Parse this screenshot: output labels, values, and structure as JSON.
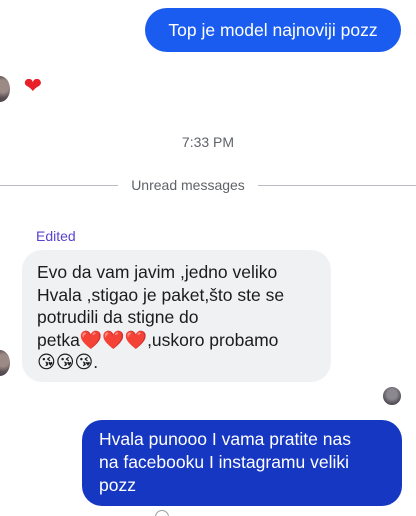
{
  "messages": {
    "outgoing_top": {
      "text": "Top je model najnoviji pozz"
    },
    "reaction": {
      "glyph": "❤",
      "icon": "heart-icon",
      "color": "#e8202a"
    },
    "timestamp": "7:33 PM",
    "divider": "Unread messages",
    "incoming": {
      "edited_label": "Edited",
      "lines": [
        "Evo da vam javim ,jedno veliko",
        "Hvala ,stigao je paket,što ste se",
        "potrudili da stigne do"
      ],
      "line4_text": "petka",
      "line4_hearts": "❤️❤️❤️",
      "line4_rest": ",uskoro probamo",
      "line5_emojis": "😘😘😘",
      "line5_end": "."
    },
    "outgoing_bottom": {
      "lines": [
        "Hvala punooo I vama pratite nas",
        "na facebooku I instagramu veliki",
        "pozz"
      ]
    }
  },
  "colors": {
    "outgoing_bubble": "#1a5cf0",
    "outgoing_bubble_dark": "#1537c2",
    "incoming_bubble": "#f0f1f3",
    "edited_label": "#5a43d0"
  }
}
